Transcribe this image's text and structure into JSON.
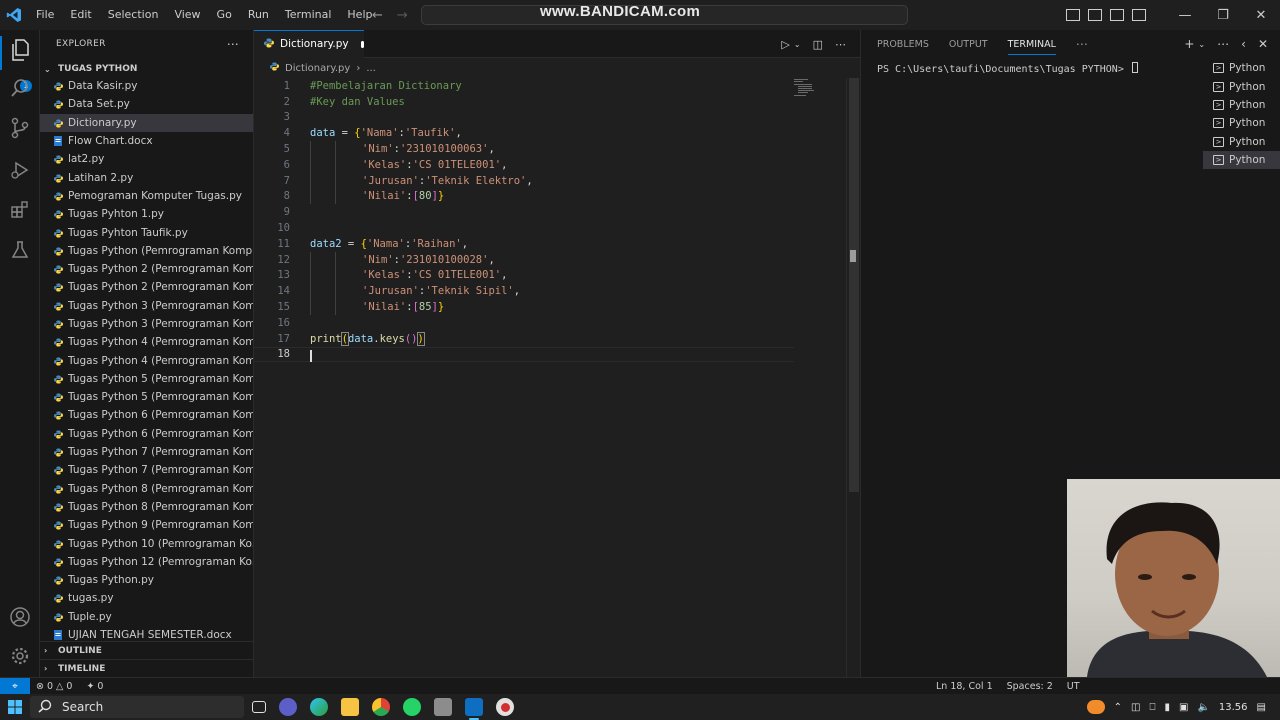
{
  "titlebar": {
    "menu": [
      "File",
      "Edit",
      "Selection",
      "View",
      "Go",
      "Run",
      "Terminal",
      "Help"
    ],
    "watermark": "www.BANDICAM.com"
  },
  "activity": {
    "explorer_badge": "1"
  },
  "sidebar": {
    "header": "EXPLORER",
    "folder": "TUGAS PYTHON",
    "files": [
      "Data Kasir.py",
      "Data Set.py",
      "Dictionary.py",
      "Flow Chart.docx",
      "lat2.py",
      "Latihan 2.py",
      "Pemograman Komputer Tugas.py",
      "Tugas Pyhton 1.py",
      "Tugas Pyhton Taufik.py",
      "Tugas Python (Pemrograman Kompu...",
      "Tugas Python 2 (Pemrograman Kom...",
      "Tugas Python 2 (Pemrograman Kom...",
      "Tugas Python 3 (Pemrograman Kom...",
      "Tugas Python 3 (Pemrograman Kom...",
      "Tugas Python 4 (Pemrograman Kom...",
      "Tugas Python 4 (Pemrograman Kom...",
      "Tugas Python 5 (Pemrograman Kom...",
      "Tugas Python 5 (Pemrograman Kom...",
      "Tugas Python 6 (Pemrograman Kom...",
      "Tugas Python 6 (Pemrograman Kom...",
      "Tugas Python 7 (Pemrograman Kom...",
      "Tugas Python 7 (Pemrograman Kom...",
      "Tugas Python 8 (Pemrograman Kom...",
      "Tugas Python 8 (Pemrograman Kom...",
      "Tugas Python 9 (Pemrograman Kom...",
      "Tugas Python 10 (Pemrograman Ko...",
      "Tugas Python 12 (Pemrograman Ko...",
      "Tugas Python.py",
      "tugas.py",
      "Tuple.py",
      "UJIAN TENGAH SEMESTER.docx"
    ],
    "outline": "OUTLINE",
    "timeline": "TIMELINE"
  },
  "editor": {
    "tab": "Dictionary.py",
    "breadcrumb_file": "Dictionary.py",
    "breadcrumb_more": "...",
    "line_numbers": [
      "1",
      "2",
      "3",
      "4",
      "5",
      "6",
      "7",
      "8",
      "9",
      "10",
      "11",
      "12",
      "13",
      "14",
      "15",
      "16",
      "17",
      "18"
    ],
    "cursor_line": "18",
    "code": {
      "l1": "#Pembelajaran Dictionary",
      "l2": "#Key dan Values",
      "data": "data",
      "data2": "data2",
      "eq": " = ",
      "k_nama": "'Nama'",
      "k_nim": "'Nim'",
      "k_kelas": "'Kelas'",
      "k_jurusan": "'Jurusan'",
      "k_nilai": "'Nilai'",
      "v_nama1": "'Taufik'",
      "v_nim1": "'231010100063'",
      "v_kelas1": "'CS 01TELE001'",
      "v_jurusan1": "'Teknik Elektro'",
      "v_nilai1": "80",
      "v_nama2": "'Raihan'",
      "v_nim2": "'231010100028'",
      "v_kelas2": "'CS 01TELE001'",
      "v_jurusan2": "'Teknik Sipil'",
      "v_nilai2": "85",
      "print": "print",
      "data_ref": "data",
      "keys": "keys"
    }
  },
  "panel": {
    "tabs": [
      "PROBLEMS",
      "OUTPUT",
      "TERMINAL"
    ],
    "prompt": "PS C:\\Users\\taufi\\Documents\\Tugas PYTHON> ",
    "terminals": [
      "Python",
      "Python",
      "Python",
      "Python",
      "Python",
      "Python"
    ]
  },
  "statusbar": {
    "errors": "0",
    "warnings": "0",
    "ports": "0",
    "position": "Ln 18, Col 1",
    "spaces": "Spaces: 2",
    "encoding": "UT"
  },
  "taskbar": {
    "search": "Search",
    "time": "13.56"
  }
}
